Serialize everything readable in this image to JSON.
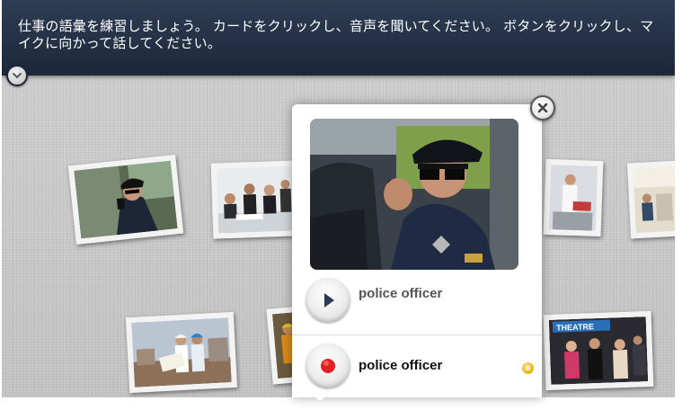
{
  "banner": {
    "instructions": "仕事の語彙を練習しましょう。 カードをクリックし、音声を聞いてください。 ボタンをクリックし、マイクに向かって話してください。"
  },
  "popup": {
    "play_label": "police officer",
    "record_label": "police officer",
    "record_status": "warning"
  },
  "cards": [
    {
      "name": "police officer"
    },
    {
      "name": "meeting"
    },
    {
      "name": "engineers"
    },
    {
      "name": "worker"
    },
    {
      "name": "nurse"
    },
    {
      "name": "office"
    },
    {
      "name": "theatre",
      "sign_text": "THEATRE"
    }
  ],
  "icons": {
    "collapse": "chevron-down-icon",
    "close": "close-icon",
    "play": "play-icon",
    "record": "record-icon",
    "status": "warning-x-icon"
  },
  "colors": {
    "banner": "#1c2739",
    "record_red": "#e22020",
    "play_navy": "#2d3a5c",
    "status_yellow": "#e7b310"
  }
}
